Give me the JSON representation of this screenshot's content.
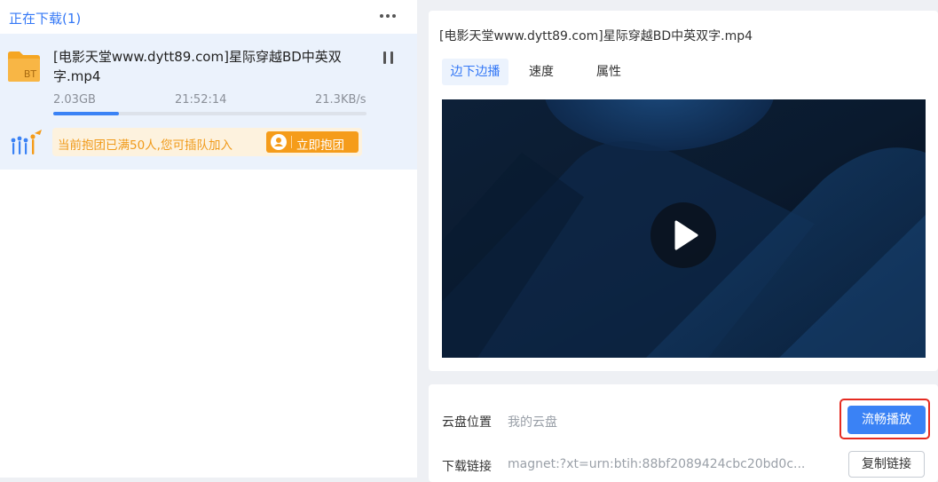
{
  "downloads_panel": {
    "title": "正在下载(1)",
    "more_icon": "more-dots-icon"
  },
  "task": {
    "name": "[电影天堂www.dytt89.com]星际穿越BD中英双字.mp4",
    "size": "2.03GB",
    "remaining_time": "21:52:14",
    "speed": "21.3KB/s",
    "progress": 0.21,
    "file_icon": "bt-file-icon",
    "file_icon_text": "BT",
    "pause_icon": "pause-icon",
    "group": {
      "message": "当前抱团已满50人,您可插队加入",
      "button_label": "立即抱团",
      "icon": "group-people-icon"
    }
  },
  "detail": {
    "title": "[电影天堂www.dytt89.com]星际穿越BD中英双字.mp4",
    "tabs": [
      {
        "label": "边下边播",
        "active": true
      },
      {
        "label": "速度",
        "active": false
      },
      {
        "label": "属性",
        "active": false
      }
    ],
    "play_icon": "play-icon"
  },
  "info": {
    "cloud_label": "云盘位置",
    "cloud_value": "我的云盘",
    "smooth_play_label": "流畅播放",
    "link_label": "下载链接",
    "link_value": "magnet:?xt=urn:btih:88bf2089424cbc20bd0c...",
    "copy_label": "复制链接"
  },
  "colors": {
    "accent": "#3a82f5",
    "group_orange": "#f59c1a",
    "highlight_red": "#e52b21"
  }
}
